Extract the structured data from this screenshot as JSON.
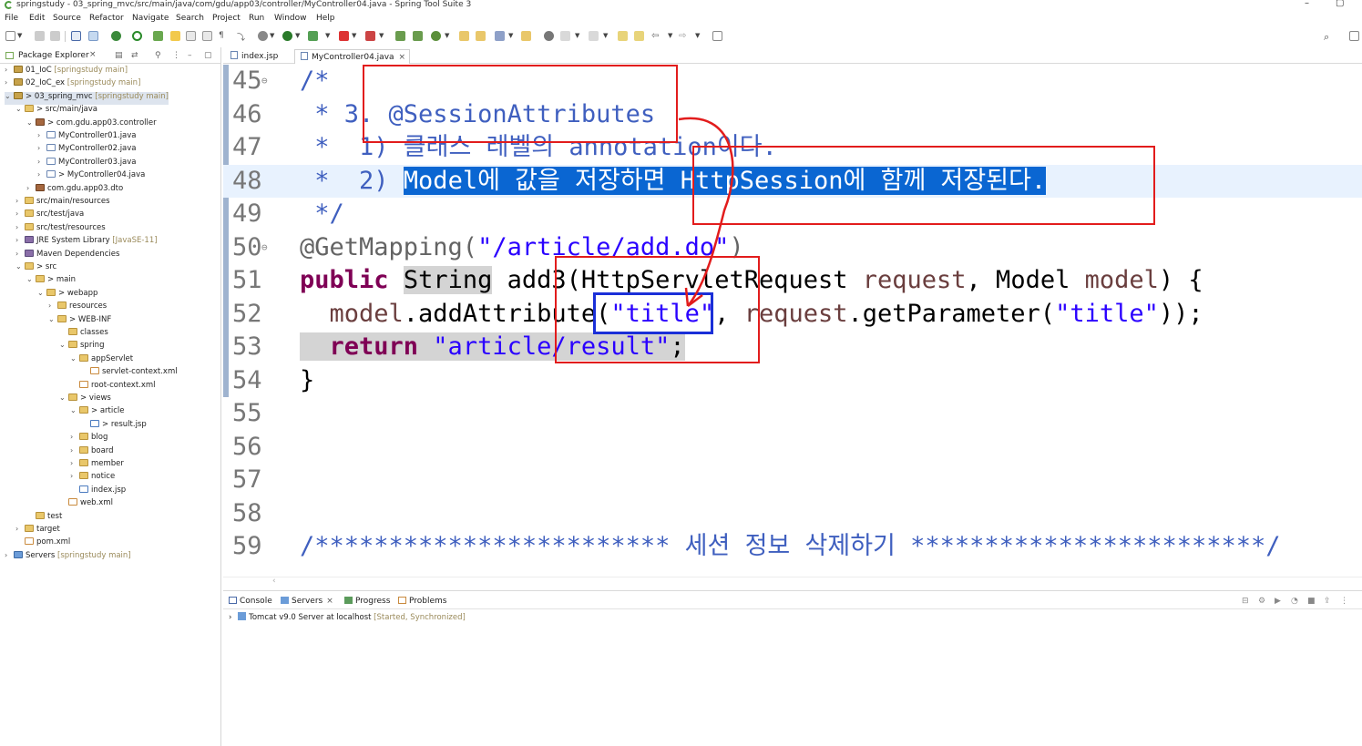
{
  "window": {
    "title": "springstudy - 03_spring_mvc/src/main/java/com/gdu/app03/controller/MyController04.java - Spring Tool Suite 3"
  },
  "menu": [
    "File",
    "Edit",
    "Source",
    "Refactor",
    "Navigate",
    "Search",
    "Project",
    "Run",
    "Window",
    "Help"
  ],
  "package_explorer": {
    "title": "Package Explorer",
    "close": "×",
    "tree": [
      {
        "label": "01_IoC",
        "deco": " [springstudy main]"
      },
      {
        "label": "02_IoC_ex",
        "deco": " [springstudy main]"
      },
      {
        "label": "> 03_spring_mvc",
        "deco": " [springstudy main]"
      },
      {
        "label": "> src/main/java",
        "deco": ""
      },
      {
        "label": "> com.gdu.app03.controller",
        "deco": ""
      },
      {
        "label": "MyController01.java",
        "deco": ""
      },
      {
        "label": "MyController02.java",
        "deco": ""
      },
      {
        "label": "MyController03.java",
        "deco": ""
      },
      {
        "label": "> MyController04.java",
        "deco": ""
      },
      {
        "label": "com.gdu.app03.dto",
        "deco": ""
      },
      {
        "label": "src/main/resources",
        "deco": ""
      },
      {
        "label": "src/test/java",
        "deco": ""
      },
      {
        "label": "src/test/resources",
        "deco": ""
      },
      {
        "label": "JRE System Library",
        "deco": " [JavaSE-11]"
      },
      {
        "label": "Maven Dependencies",
        "deco": ""
      },
      {
        "label": "> src",
        "deco": ""
      },
      {
        "label": "> main",
        "deco": ""
      },
      {
        "label": "> webapp",
        "deco": ""
      },
      {
        "label": "resources",
        "deco": ""
      },
      {
        "label": "> WEB-INF",
        "deco": ""
      },
      {
        "label": "classes",
        "deco": ""
      },
      {
        "label": "spring",
        "deco": ""
      },
      {
        "label": "appServlet",
        "deco": ""
      },
      {
        "label": "servlet-context.xml",
        "deco": ""
      },
      {
        "label": "root-context.xml",
        "deco": ""
      },
      {
        "label": "> views",
        "deco": ""
      },
      {
        "label": "> article",
        "deco": ""
      },
      {
        "label": "> result.jsp",
        "deco": ""
      },
      {
        "label": "blog",
        "deco": ""
      },
      {
        "label": "board",
        "deco": ""
      },
      {
        "label": "member",
        "deco": ""
      },
      {
        "label": "notice",
        "deco": ""
      },
      {
        "label": "index.jsp",
        "deco": ""
      },
      {
        "label": "web.xml",
        "deco": ""
      },
      {
        "label": "test",
        "deco": ""
      },
      {
        "label": "target",
        "deco": ""
      },
      {
        "label": "pom.xml",
        "deco": ""
      },
      {
        "label": "Servers",
        "deco": " [springstudy main]"
      }
    ]
  },
  "editor": {
    "tabs": [
      {
        "label": "index.jsp"
      },
      {
        "label": "MyController04.java",
        "close": "×"
      }
    ],
    "lines": {
      "n45": "45",
      "n46": "46",
      "n47": "47",
      "n48": "48",
      "n49": "49",
      "n50": "50",
      "n51": "51",
      "n52": "52",
      "n53": "53",
      "n54": "54",
      "n55": "55",
      "n56": "56",
      "n57": "57",
      "n58": "58",
      "n59": "59",
      "l45": "/*",
      "l46": " * 3. @SessionAttributes",
      "l47": " *  1) 클래스 레벨의 annotation이다.",
      "l48_pre": " *  2) ",
      "l48_sel": "Model에 값을 저장하면 HttpSession에 함께 저장된다.",
      "l49": " */",
      "l50_ann": "@GetMapping(",
      "l50_str": "\"/article/add.do\"",
      "l50_end": ")",
      "l51_kw": "public",
      "l51_type": "String",
      "l51_rest1": " add3(HttpServletRequest ",
      "l51_v1": "request",
      "l51_rest2": ", Model ",
      "l51_v2": "model",
      "l51_rest3": ") {",
      "l52_v": "  model",
      "l52_a": ".addAttribute(",
      "l52_s1": "\"title\"",
      "l52_b": ", ",
      "l52_v2": "request",
      "l52_c": ".getParameter(",
      "l52_s2": "\"title\"",
      "l52_d": "));",
      "l53_kw": "  return",
      "l53_s": " \"article/result\"",
      "l53_e": ";",
      "l54": "}",
      "l59": "/************************ 세션 정보 삭제하기 ************************/"
    }
  },
  "bottom_panel": {
    "tabs": [
      "Console",
      "Servers",
      "Progress",
      "Problems"
    ],
    "servers_close": "×",
    "server_row": {
      "label": "Tomcat v9.0 Server at localhost",
      "status": " [Started, Synchronized]"
    }
  },
  "colors": {
    "annotation_red": "#e21c1c",
    "annotation_blue": "#1a2fd8",
    "selection": "#0a66d2"
  }
}
